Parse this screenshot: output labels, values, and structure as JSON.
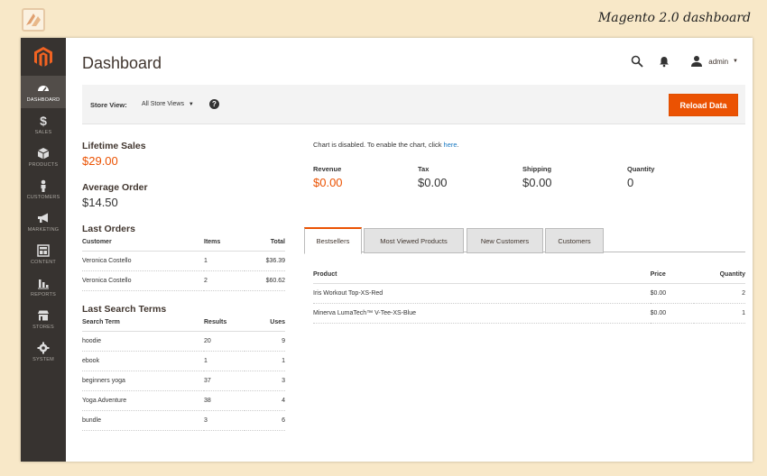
{
  "caption": "Magento 2.0 dashboard",
  "sidebar": {
    "items": [
      {
        "label": "DASHBOARD",
        "icon": "dashboard-icon"
      },
      {
        "label": "SALES",
        "icon": "dollar-icon"
      },
      {
        "label": "PRODUCTS",
        "icon": "cube-icon"
      },
      {
        "label": "CUSTOMERS",
        "icon": "person-icon"
      },
      {
        "label": "MARKETING",
        "icon": "megaphone-icon"
      },
      {
        "label": "CONTENT",
        "icon": "layout-icon"
      },
      {
        "label": "REPORTS",
        "icon": "bar-chart-icon"
      },
      {
        "label": "STORES",
        "icon": "store-icon"
      },
      {
        "label": "SYSTEM",
        "icon": "gear-icon"
      }
    ]
  },
  "header": {
    "title": "Dashboard",
    "user": "admin"
  },
  "store_bar": {
    "label": "Store View:",
    "selected": "All Store Views",
    "help": "?",
    "reload_label": "Reload Data"
  },
  "lifetime": {
    "label": "Lifetime Sales",
    "value": "$29.00"
  },
  "average": {
    "label": "Average Order",
    "value": "$14.50"
  },
  "last_orders": {
    "title": "Last Orders",
    "headers": [
      "Customer",
      "Items",
      "Total"
    ],
    "rows": [
      [
        "Veronica Costello",
        "1",
        "$36.39"
      ],
      [
        "Veronica Costello",
        "2",
        "$60.62"
      ]
    ]
  },
  "last_search": {
    "title": "Last Search Terms",
    "headers": [
      "Search Term",
      "Results",
      "Uses"
    ],
    "rows": [
      [
        "hoodie",
        "20",
        "9"
      ],
      [
        "ebook",
        "1",
        "1"
      ],
      [
        "beginners yoga",
        "37",
        "3"
      ],
      [
        "Yoga Adventure",
        "38",
        "4"
      ],
      [
        "bundle",
        "3",
        "6"
      ]
    ]
  },
  "chart_msg": {
    "text": "Chart is disabled. To enable the chart, click ",
    "link": "here",
    "end": "."
  },
  "totals": [
    {
      "label": "Revenue",
      "value": "$0.00"
    },
    {
      "label": "Tax",
      "value": "$0.00"
    },
    {
      "label": "Shipping",
      "value": "$0.00"
    },
    {
      "label": "Quantity",
      "value": "0"
    }
  ],
  "tabs": [
    "Bestsellers",
    "Most Viewed Products",
    "New Customers",
    "Customers"
  ],
  "bestsellers": {
    "headers": [
      "Product",
      "Price",
      "Quantity"
    ],
    "rows": [
      [
        "Iris Workout Top-XS-Red",
        "$0.00",
        "2"
      ],
      [
        "Minerva LumaTech™ V-Tee-XS-Blue",
        "$0.00",
        "1"
      ]
    ]
  },
  "colors": {
    "accent": "#eb5202",
    "sidebar": "#373330",
    "link": "#1979c3"
  }
}
